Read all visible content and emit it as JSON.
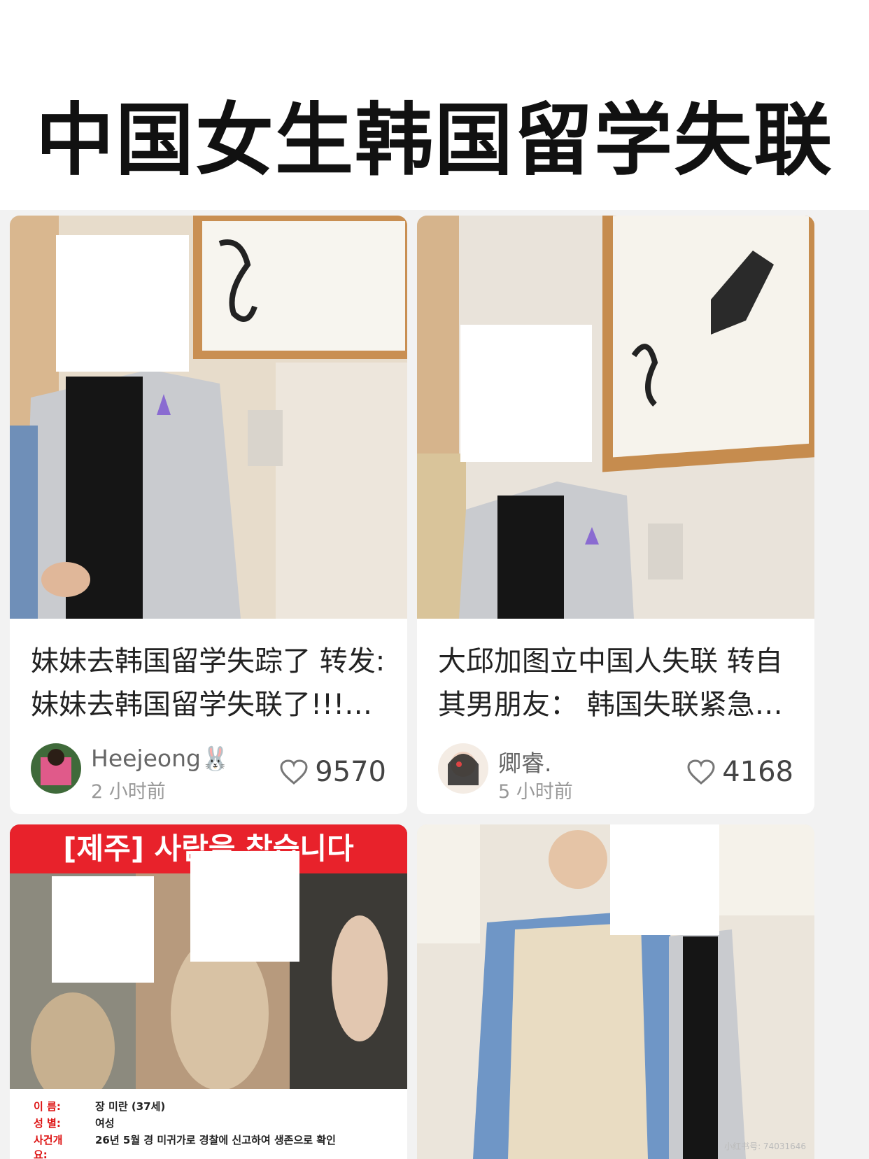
{
  "headline": "中国女生韩国留学失联",
  "cards": [
    {
      "title": "妹妹去韩国留学失踪了 转发: 妹妹去韩国留学失联了!!!…",
      "author": "Heejeong🐰",
      "time": "2 小时前",
      "likes": "9570"
    },
    {
      "title": "大邱加图立中国人失联 转自其男朋友： 韩国失联紧急…",
      "author": "卿睿.",
      "time": "5 小时前",
      "likes": "4168"
    }
  ],
  "poster": {
    "banner": "[제주] 사람을 찾습니다",
    "rows": [
      {
        "k": "이 름:",
        "v": "장 미란 (37세)"
      },
      {
        "k": "성 별:",
        "v": "여성"
      },
      {
        "k": "사건개요:",
        "v": "26년 5월 경 미귀가로 경찰에 신고하여 생존으로 확인"
      }
    ]
  },
  "watermark": "小红书号: 74031646",
  "icons": {
    "like": "heart-outline-icon"
  }
}
